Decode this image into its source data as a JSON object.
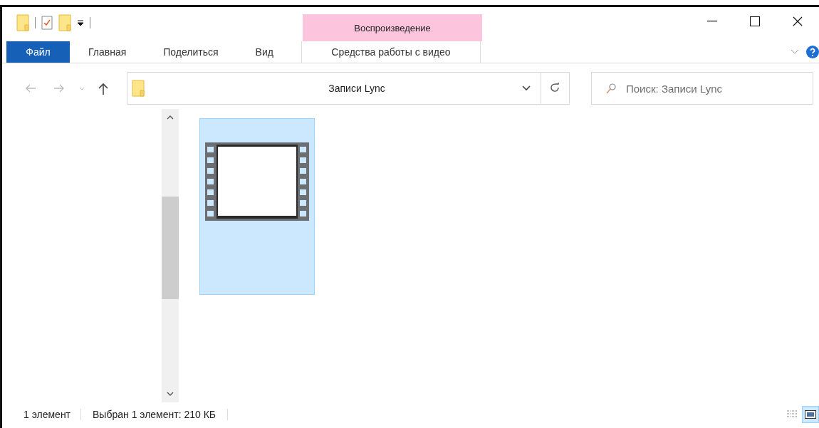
{
  "contextual_header": {
    "label": "Воспроизведение"
  },
  "ribbon_tabs": [
    {
      "label": "Файл",
      "kind": "file"
    },
    {
      "label": "Главная",
      "kind": "normal"
    },
    {
      "label": "Поделиться",
      "kind": "normal"
    },
    {
      "label": "Вид",
      "kind": "normal"
    },
    {
      "label": "Средства работы с видео",
      "kind": "contextual"
    }
  ],
  "address_bar": {
    "path": "Записи Lync"
  },
  "search": {
    "placeholder": "Поиск: Записи Lync"
  },
  "files": [
    {
      "kind": "video",
      "selected": true
    }
  ],
  "status_bar": {
    "count": "1 элемент",
    "selection": "Выбран 1 элемент: 210 КБ"
  },
  "views": [
    {
      "kind": "details",
      "selected": false
    },
    {
      "kind": "large-icons",
      "selected": true
    }
  ]
}
